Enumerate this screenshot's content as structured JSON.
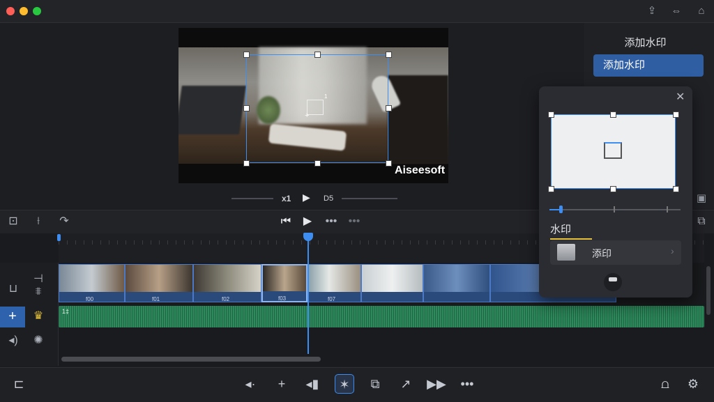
{
  "window": {
    "icons": [
      "share-icon",
      "arrow-swap-icon",
      "trash-icon"
    ],
    "colors": {
      "close": "#ff5f57",
      "minimize": "#febc2e",
      "zoom": "#28c840",
      "accent": "#3e8df0"
    }
  },
  "preview": {
    "watermark_text": "Aiseesoft",
    "handle_label": "1",
    "speed_label": "x1",
    "time_label": "D5"
  },
  "right_panel": {
    "title": "添加水印",
    "button_label": "添加水印"
  },
  "toolbar": {
    "left_icons": [
      "crop-icon",
      "split-icon",
      "redo-icon"
    ],
    "center_icons": [
      "skip-back-icon",
      "play-icon",
      "dots-icon",
      "dots-icon"
    ],
    "right_icons": [
      "save-icon",
      "copy-icon"
    ]
  },
  "timeline": {
    "clip_labels": [
      "f00",
      "f01",
      "f02",
      "f03",
      "f07",
      "",
      "",
      ""
    ],
    "audio_label": "1‡"
  },
  "popup": {
    "label": "水印",
    "item_label": "添印",
    "item_chevron": "›"
  },
  "bottombar": {
    "icons": [
      "folder-icon",
      "audio-left-icon",
      "plus-icon",
      "rewind-icon",
      "sparkle-icon",
      "layers-icon",
      "share-arrow-icon",
      "fast-forward-icon",
      "more-icon",
      "bell-icon",
      "settings-gear-icon"
    ]
  }
}
